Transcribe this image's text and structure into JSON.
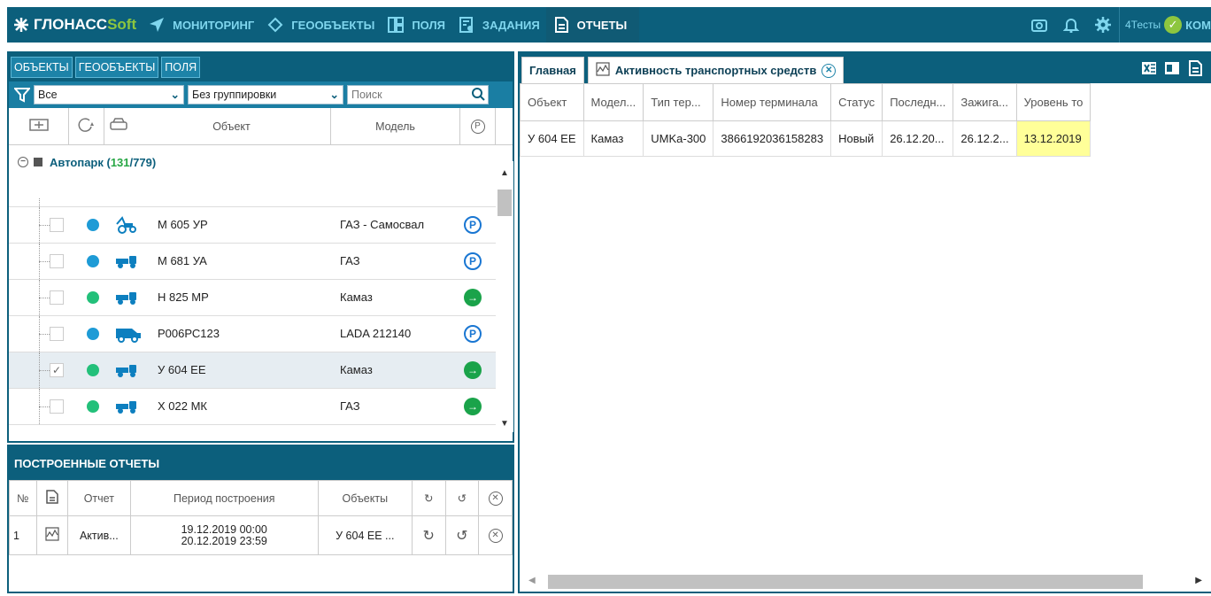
{
  "app": {
    "logo_main": "ГЛОНАСС",
    "logo_soft": "Soft"
  },
  "nav": [
    {
      "label": "МОНИТОРИНГ",
      "icon": "navigation-arrow-icon"
    },
    {
      "label": "ГЕООБЪЕКТЫ",
      "icon": "geoobject-icon"
    },
    {
      "label": "ПОЛЯ",
      "icon": "fields-icon"
    },
    {
      "label": "ЗАДАНИЯ",
      "icon": "tasks-icon"
    },
    {
      "label": "ОТЧЕТЫ",
      "icon": "reports-icon",
      "active": true
    }
  ],
  "topright": {
    "user_prefix": "4Тесты",
    "user_name": "КОМ"
  },
  "left": {
    "tabs": [
      "ОБЪЕКТЫ",
      "ГЕООБЪЕКТЫ",
      "ПОЛЯ"
    ],
    "filter_value": "Все",
    "grouping_value": "Без группировки",
    "search_placeholder": "Поиск",
    "col_object": "Объект",
    "col_model": "Модель",
    "group": {
      "name": "Автопарк (",
      "active": "131",
      "total": "/779)"
    },
    "rows": [
      {
        "name": "М 605 УР",
        "model": "ГАЗ - Самосвал",
        "status": "P",
        "dot": "#1e9bd6",
        "vehicle": "tractor-icon",
        "checked": "",
        "selected": false
      },
      {
        "name": "М 681 УА",
        "model": "ГАЗ",
        "status": "P",
        "dot": "#1e9bd6",
        "vehicle": "truck-icon",
        "checked": "",
        "selected": false
      },
      {
        "name": "Н 825 МР",
        "model": "Камаз",
        "status": "→",
        "dot": "#23c07a",
        "vehicle": "truck-icon",
        "checked": "",
        "selected": false
      },
      {
        "name": "Р006РС123",
        "model": "LADA 212140",
        "status": "P",
        "dot": "#1e9bd6",
        "vehicle": "van-icon",
        "checked": "",
        "selected": false
      },
      {
        "name": "У 604 ЕЕ",
        "model": "Камаз",
        "status": "→",
        "dot": "#23c07a",
        "vehicle": "truck-icon",
        "checked": "✓",
        "selected": true
      },
      {
        "name": "Х 022 МК",
        "model": "ГАЗ",
        "status": "→",
        "dot": "#23c07a",
        "vehicle": "truck-icon",
        "checked": "",
        "selected": false
      }
    ]
  },
  "reports": {
    "title": "ПОСТРОЕННЫЕ ОТЧЕТЫ",
    "headers": {
      "num": "№",
      "report": "Отчет",
      "period": "Период построения",
      "objects": "Объекты"
    },
    "rows": [
      {
        "num": "1",
        "report": "Актив...",
        "period_from": "19.12.2019 00:00",
        "period_to": "20.12.2019 23:59",
        "objects": "У 604 ЕЕ ..."
      }
    ]
  },
  "right": {
    "tabs": [
      {
        "label": "Главная"
      },
      {
        "label": "Активность транспортных средств",
        "closable": true
      }
    ],
    "columns": [
      "Объект",
      "Модел...",
      "Тип тер...",
      "Номер терминала",
      "Статус",
      "Последн...",
      "Зажига...",
      "Уровень то"
    ],
    "rows": [
      [
        "У 604 ЕЕ",
        "Камаз",
        "UMKa-300",
        "3866192036158283",
        "Новый",
        "26.12.20...",
        "26.12.2...",
        "13.12.2019"
      ]
    ]
  },
  "colors": {
    "primary": "#0c5f7c",
    "accent_green": "#8dc63f",
    "status_green": "#1aa34a",
    "status_blue": "#1976d2",
    "highlight": "#ffff99"
  }
}
